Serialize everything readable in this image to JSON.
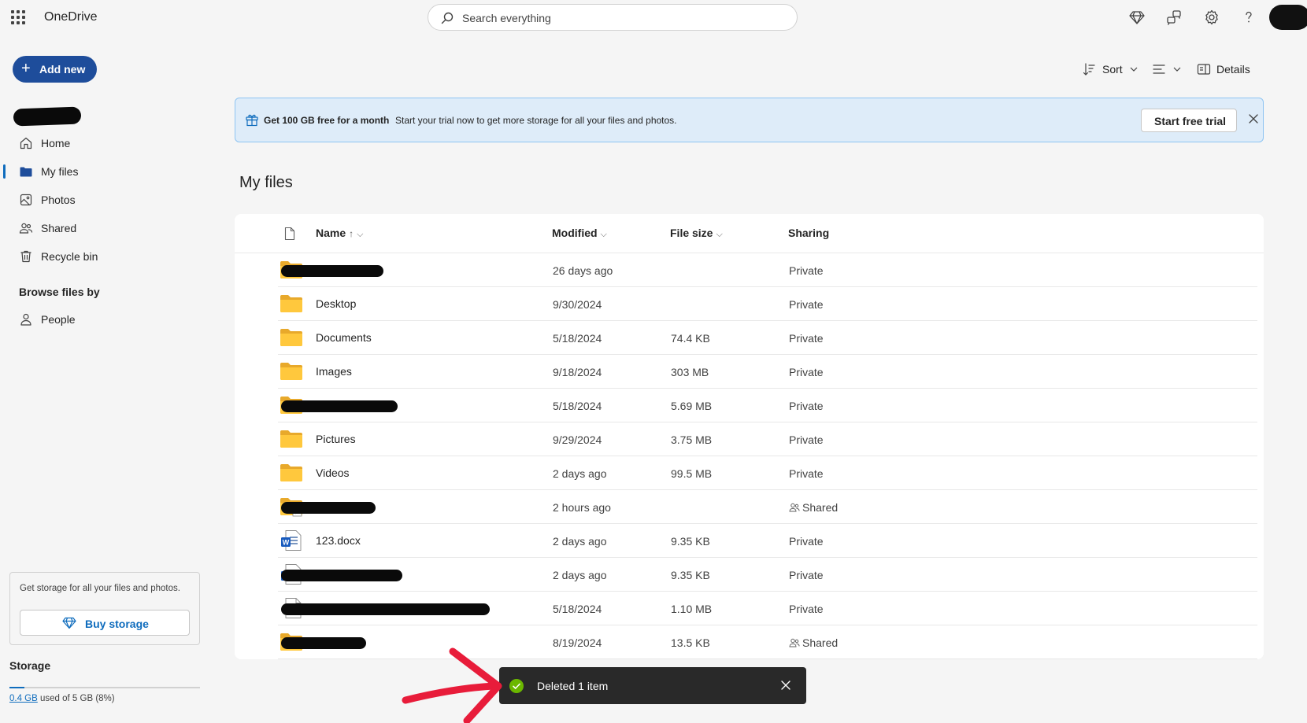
{
  "app": {
    "title": "OneDrive"
  },
  "search": {
    "placeholder": "Search everything"
  },
  "top_icons": [
    "diamond-premium-icon",
    "feedback-icon",
    "settings-gear-icon",
    "help-question-icon"
  ],
  "sidebar": {
    "add_new_label": "Add new",
    "nav": [
      {
        "label": "Home",
        "icon": "home-icon"
      },
      {
        "label": "My files",
        "icon": "folder-icon",
        "active": true
      },
      {
        "label": "Photos",
        "icon": "photos-icon"
      },
      {
        "label": "Shared",
        "icon": "shared-people-icon"
      },
      {
        "label": "Recycle bin",
        "icon": "recycle-bin-icon"
      }
    ],
    "browse_heading": "Browse files by",
    "browse_items": [
      {
        "label": "People",
        "icon": "person-icon"
      }
    ],
    "storage_card_text": "Get storage for all your files and photos.",
    "buy_storage_label": "Buy storage",
    "storage_heading": "Storage",
    "storage_used": "0.4 GB",
    "storage_rest": "used of 5 GB (8%)",
    "storage_fraction": 0.08
  },
  "command_bar": {
    "sort_label": "Sort",
    "details_label": "Details"
  },
  "banner": {
    "title": "Get 100 GB free for a month",
    "text": "Start your trial now to get more storage for all your files and photos.",
    "button_label": "Start free trial"
  },
  "page_title": "My files",
  "table": {
    "columns": {
      "name": "Name",
      "modified": "Modified",
      "size": "File size",
      "sharing": "Sharing"
    },
    "rows": [
      {
        "name": "",
        "modified": "26 days ago",
        "size": "",
        "sharing": "Private",
        "type": "folder",
        "redacted": true
      },
      {
        "name": "Desktop",
        "modified": "9/30/2024",
        "size": "",
        "sharing": "Private",
        "type": "folder"
      },
      {
        "name": "Documents",
        "modified": "5/18/2024",
        "size": "74.4 KB",
        "sharing": "Private",
        "type": "folder"
      },
      {
        "name": "Images",
        "modified": "9/18/2024",
        "size": "303 MB",
        "sharing": "Private",
        "type": "folder"
      },
      {
        "name": "",
        "modified": "5/18/2024",
        "size": "5.69 MB",
        "sharing": "Private",
        "type": "folder",
        "redacted": true
      },
      {
        "name": "Pictures",
        "modified": "9/29/2024",
        "size": "3.75 MB",
        "sharing": "Private",
        "type": "folder"
      },
      {
        "name": "Videos",
        "modified": "2 days ago",
        "size": "99.5 MB",
        "sharing": "Private",
        "type": "folder"
      },
      {
        "name": "",
        "modified": "2 hours ago",
        "size": "",
        "sharing": "Shared",
        "type": "shared-folder",
        "redacted": true
      },
      {
        "name": "123.docx",
        "modified": "2 days ago",
        "size": "9.35 KB",
        "sharing": "Private",
        "type": "word"
      },
      {
        "name": "",
        "modified": "2 days ago",
        "size": "9.35 KB",
        "sharing": "Private",
        "type": "word",
        "redacted": true
      },
      {
        "name": "",
        "modified": "5/18/2024",
        "size": "1.10 MB",
        "sharing": "Private",
        "type": "file",
        "redacted": true
      },
      {
        "name": "",
        "modified": "8/19/2024",
        "size": "13.5 KB",
        "sharing": "Shared",
        "type": "folder",
        "redacted": true
      }
    ]
  },
  "toast": {
    "text": "Deleted 1 item"
  },
  "colors": {
    "accent": "#0f6cbd",
    "add_new_bg": "#1e4d9b",
    "banner_bg": "#deecf9",
    "folder": "#ffc83d",
    "toast_bg": "#292929",
    "success": "#6bb700",
    "annotation_arrow": "#e81c3a"
  }
}
